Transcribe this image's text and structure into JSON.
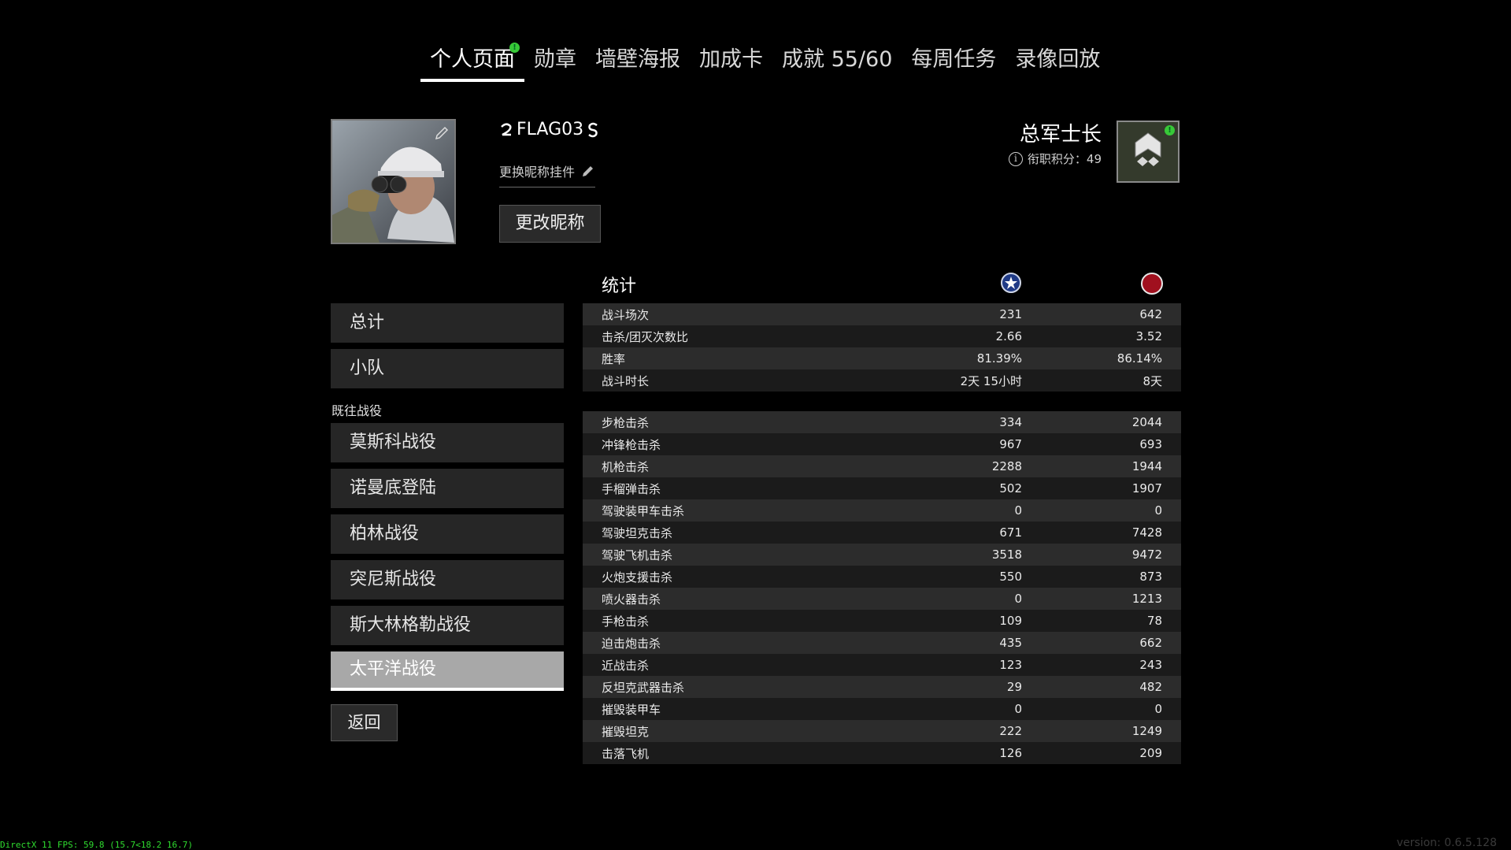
{
  "tabs": [
    {
      "label": "个人页面",
      "active": true,
      "notification": "!"
    },
    {
      "label": "勋章"
    },
    {
      "label": "墙壁海报"
    },
    {
      "label": "加成卡"
    },
    {
      "label": "成就 55/60"
    },
    {
      "label": "每周任务"
    },
    {
      "label": "录像回放"
    }
  ],
  "profile": {
    "nickname": "FLAG03",
    "change_plate_label": "更换昵称挂件",
    "rename_button": "更改昵称",
    "rank_name": "总军士长",
    "rank_points": "衔职积分：49",
    "rank_badge_notification": "!"
  },
  "menu": {
    "items": [
      "总计",
      "小队"
    ],
    "section_label": "既往战役",
    "campaigns": [
      "莫斯科战役",
      "诺曼底登陆",
      "柏林战役",
      "突尼斯战役",
      "斯大林格勒战役",
      "太平洋战役"
    ],
    "active": "太平洋战役",
    "back_button": "返回"
  },
  "stats": {
    "title": "统计",
    "factions": {
      "allies_icon": "star-emblem-icon",
      "axis_icon": "red-circle-emblem-icon"
    },
    "summary": [
      {
        "label": "战斗场次",
        "a": "231",
        "b": "642"
      },
      {
        "label": "击杀/团灭次数比",
        "a": "2.66",
        "b": "3.52"
      },
      {
        "label": "胜率",
        "a": "81.39%",
        "b": "86.14%"
      },
      {
        "label": "战斗时长",
        "a": "2天 15小时",
        "b": "8天"
      }
    ],
    "kills": [
      {
        "label": "步枪击杀",
        "a": "334",
        "b": "2044"
      },
      {
        "label": "冲锋枪击杀",
        "a": "967",
        "b": "693"
      },
      {
        "label": "机枪击杀",
        "a": "2288",
        "b": "1944"
      },
      {
        "label": "手榴弹击杀",
        "a": "502",
        "b": "1907"
      },
      {
        "label": "驾驶装甲车击杀",
        "a": "0",
        "b": "0"
      },
      {
        "label": "驾驶坦克击杀",
        "a": "671",
        "b": "7428"
      },
      {
        "label": "驾驶飞机击杀",
        "a": "3518",
        "b": "9472"
      },
      {
        "label": "火炮支援击杀",
        "a": "550",
        "b": "873"
      },
      {
        "label": "喷火器击杀",
        "a": "0",
        "b": "1213"
      },
      {
        "label": "手枪击杀",
        "a": "109",
        "b": "78"
      },
      {
        "label": "迫击炮击杀",
        "a": "435",
        "b": "662"
      },
      {
        "label": "近战击杀",
        "a": "123",
        "b": "243"
      },
      {
        "label": "反坦克武器击杀",
        "a": "29",
        "b": "482"
      },
      {
        "label": "摧毁装甲车",
        "a": "0",
        "b": "0"
      },
      {
        "label": "摧毁坦克",
        "a": "222",
        "b": "1249"
      },
      {
        "label": "击落飞机",
        "a": "126",
        "b": "209"
      }
    ]
  },
  "overlay": {
    "fps": "DirectX 11 FPS: 59.8 (15.7<18.2 16.7)",
    "version": "version: 0.6.5.128"
  }
}
